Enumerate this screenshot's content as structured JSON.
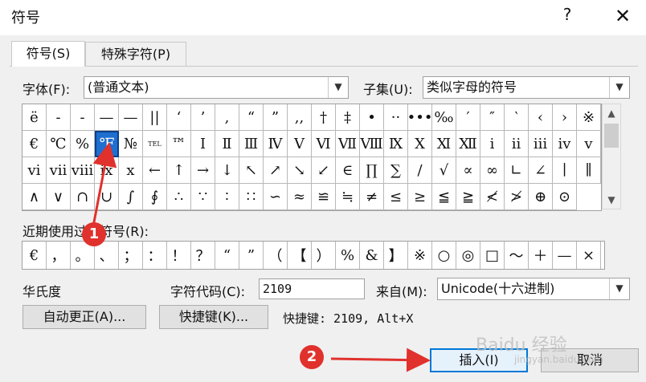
{
  "dialog": {
    "title": "符号",
    "help": "?",
    "close": "✕"
  },
  "tabs": [
    {
      "label": "符号(S)"
    },
    {
      "label": "特殊字符(P)"
    }
  ],
  "font": {
    "label": "字体(F):",
    "value": "(普通文本)"
  },
  "subset": {
    "label": "子集(U):",
    "value": "类似字母的符号"
  },
  "symbols": [
    "ë",
    "-",
    "-",
    "—",
    "—",
    "||",
    "‘",
    "’",
    ",",
    "“",
    "”",
    ",,",
    "†",
    "‡",
    "•",
    "··",
    "•••",
    "‰",
    "′",
    "″",
    "‵",
    "‹",
    "›",
    "※",
    "€",
    "℃",
    "%",
    "℉",
    "№",
    "TEL",
    "™",
    "Ⅰ",
    "Ⅱ",
    "Ⅲ",
    "Ⅳ",
    "Ⅴ",
    "Ⅵ",
    "Ⅶ",
    "Ⅷ",
    "Ⅸ",
    "Ⅹ",
    "Ⅺ",
    "Ⅻ",
    "ⅰ",
    "ⅱ",
    "ⅲ",
    "ⅳ",
    "ⅴ",
    "ⅵ",
    "ⅶ",
    "ⅷ",
    "ⅸ",
    "ⅹ",
    "←",
    "↑",
    "→",
    "↓",
    "↖",
    "↗",
    "↘",
    "↙",
    "∈",
    "∏",
    "∑",
    "∕",
    "√",
    "∝",
    "∞",
    "∟",
    "∠",
    "∣",
    "∥",
    "∧",
    "∨",
    "∩",
    "∪",
    "∫",
    "∮",
    "∴",
    "∵",
    "∶",
    "∷",
    "∽",
    "≈",
    "≌",
    "≒",
    "≠",
    "≤",
    "≥",
    "≦",
    "≧",
    "≮",
    "≯",
    "⊕",
    "⊙"
  ],
  "selected_symbol": "℉",
  "recent": {
    "label": "近期使用过的符号(R):",
    "items": [
      "€",
      "，",
      "。",
      "、",
      "；",
      "：",
      "！",
      "？",
      "“",
      "”",
      "（",
      "【",
      "）",
      "%",
      "&",
      "】",
      "※",
      "○",
      "◎",
      "□",
      "～",
      "＋",
      "—",
      "×"
    ]
  },
  "char_name": {
    "label": "华氏度"
  },
  "char_code": {
    "label": "字符代码(C):",
    "value": "2109"
  },
  "from": {
    "label": "来自(M):",
    "value": "Unicode(十六进制)"
  },
  "buttons": {
    "autocorrect": "自动更正(A)...",
    "shortcut": "快捷键(K)...",
    "insert": "插入(I)",
    "cancel": "取消"
  },
  "shortcut_text": "快捷键: 2109, Alt+X",
  "markers": [
    "1",
    "2"
  ],
  "watermark": {
    "text": "Baidu 经验",
    "sub": "jingyan.baidu.com"
  },
  "colors": {
    "selection": "#1e6fd0",
    "marker": "#e0312d",
    "default_button_border": "#0078d7"
  }
}
